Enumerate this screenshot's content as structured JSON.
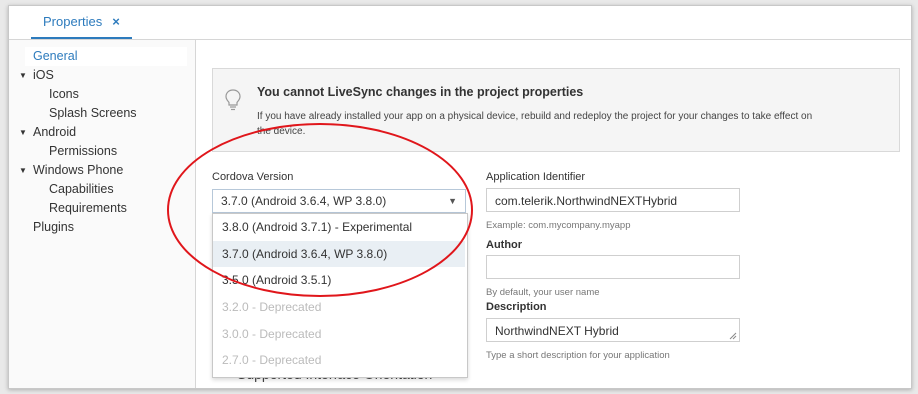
{
  "tab": {
    "label": "Properties",
    "close_glyph": "×"
  },
  "sidebar": {
    "items": [
      {
        "label": "General"
      },
      {
        "label": "iOS"
      },
      {
        "label": "Icons"
      },
      {
        "label": "Splash Screens"
      },
      {
        "label": "Android"
      },
      {
        "label": "Permissions"
      },
      {
        "label": "Windows Phone"
      },
      {
        "label": "Capabilities"
      },
      {
        "label": "Requirements"
      },
      {
        "label": "Plugins"
      }
    ]
  },
  "notice": {
    "icon": "lightbulb-icon",
    "title": "You cannot LiveSync changes in the project properties",
    "text": "If you have already installed your app on a physical device, rebuild and redeploy the project for your changes to take effect on the device."
  },
  "cordova": {
    "label": "Cordova Version",
    "selected": "3.7.0 (Android 3.6.4, WP 3.8.0)",
    "options": [
      {
        "label": "3.8.0 (Android 3.7.1) - Experimental",
        "state": "normal"
      },
      {
        "label": "3.7.0 (Android 3.6.4, WP 3.8.0)",
        "state": "selected"
      },
      {
        "label": "3.5.0 (Android 3.5.1)",
        "state": "normal"
      },
      {
        "label": "3.2.0 - Deprecated",
        "state": "disabled"
      },
      {
        "label": "3.0.0 - Deprecated",
        "state": "disabled"
      },
      {
        "label": "2.7.0 - Deprecated",
        "state": "disabled"
      }
    ]
  },
  "app_id": {
    "label": "Application Identifier",
    "value": "com.telerik.NorthwindNEXTHybrid",
    "hint": "Example: com.mycompany.myapp"
  },
  "author": {
    "label": "Author",
    "value": "",
    "hint": "By default, your user name"
  },
  "description": {
    "label": "Description",
    "value": "NorthwindNEXT Hybrid",
    "hint": "Type a short description for your application"
  },
  "partially_hidden_section": "Supported Interface Orientation",
  "colors": {
    "accent": "#2d7bbd",
    "annotation": "#e0161b"
  }
}
